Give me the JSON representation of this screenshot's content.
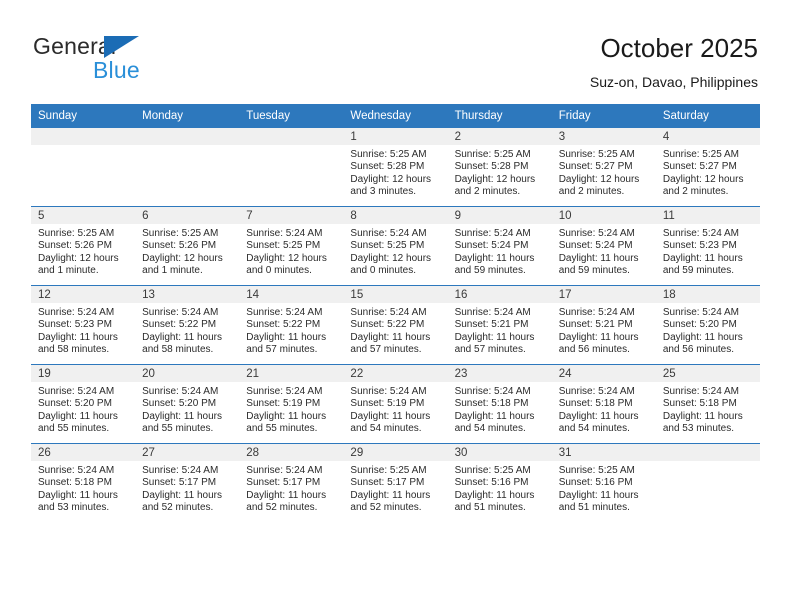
{
  "brand": {
    "name_top": "General",
    "name_bottom": "Blue",
    "accent_color": "#2a8fd8",
    "triangle_color": "#1b6cb5"
  },
  "header": {
    "title": "October 2025",
    "subtitle": "Suz-on, Davao, Philippines"
  },
  "theme": {
    "header_band": "#2d78bd",
    "daynum_band": "#f0f0f0",
    "text": "#2b2b2b"
  },
  "weekday_headers": [
    "Sunday",
    "Monday",
    "Tuesday",
    "Wednesday",
    "Thursday",
    "Friday",
    "Saturday"
  ],
  "weeks": [
    [
      {
        "day": "",
        "sunrise": "",
        "sunset": "",
        "daylight": ""
      },
      {
        "day": "",
        "sunrise": "",
        "sunset": "",
        "daylight": ""
      },
      {
        "day": "",
        "sunrise": "",
        "sunset": "",
        "daylight": ""
      },
      {
        "day": "1",
        "sunrise": "Sunrise: 5:25 AM",
        "sunset": "Sunset: 5:28 PM",
        "daylight": "Daylight: 12 hours and 3 minutes."
      },
      {
        "day": "2",
        "sunrise": "Sunrise: 5:25 AM",
        "sunset": "Sunset: 5:28 PM",
        "daylight": "Daylight: 12 hours and 2 minutes."
      },
      {
        "day": "3",
        "sunrise": "Sunrise: 5:25 AM",
        "sunset": "Sunset: 5:27 PM",
        "daylight": "Daylight: 12 hours and 2 minutes."
      },
      {
        "day": "4",
        "sunrise": "Sunrise: 5:25 AM",
        "sunset": "Sunset: 5:27 PM",
        "daylight": "Daylight: 12 hours and 2 minutes."
      }
    ],
    [
      {
        "day": "5",
        "sunrise": "Sunrise: 5:25 AM",
        "sunset": "Sunset: 5:26 PM",
        "daylight": "Daylight: 12 hours and 1 minute."
      },
      {
        "day": "6",
        "sunrise": "Sunrise: 5:25 AM",
        "sunset": "Sunset: 5:26 PM",
        "daylight": "Daylight: 12 hours and 1 minute."
      },
      {
        "day": "7",
        "sunrise": "Sunrise: 5:24 AM",
        "sunset": "Sunset: 5:25 PM",
        "daylight": "Daylight: 12 hours and 0 minutes."
      },
      {
        "day": "8",
        "sunrise": "Sunrise: 5:24 AM",
        "sunset": "Sunset: 5:25 PM",
        "daylight": "Daylight: 12 hours and 0 minutes."
      },
      {
        "day": "9",
        "sunrise": "Sunrise: 5:24 AM",
        "sunset": "Sunset: 5:24 PM",
        "daylight": "Daylight: 11 hours and 59 minutes."
      },
      {
        "day": "10",
        "sunrise": "Sunrise: 5:24 AM",
        "sunset": "Sunset: 5:24 PM",
        "daylight": "Daylight: 11 hours and 59 minutes."
      },
      {
        "day": "11",
        "sunrise": "Sunrise: 5:24 AM",
        "sunset": "Sunset: 5:23 PM",
        "daylight": "Daylight: 11 hours and 59 minutes."
      }
    ],
    [
      {
        "day": "12",
        "sunrise": "Sunrise: 5:24 AM",
        "sunset": "Sunset: 5:23 PM",
        "daylight": "Daylight: 11 hours and 58 minutes."
      },
      {
        "day": "13",
        "sunrise": "Sunrise: 5:24 AM",
        "sunset": "Sunset: 5:22 PM",
        "daylight": "Daylight: 11 hours and 58 minutes."
      },
      {
        "day": "14",
        "sunrise": "Sunrise: 5:24 AM",
        "sunset": "Sunset: 5:22 PM",
        "daylight": "Daylight: 11 hours and 57 minutes."
      },
      {
        "day": "15",
        "sunrise": "Sunrise: 5:24 AM",
        "sunset": "Sunset: 5:22 PM",
        "daylight": "Daylight: 11 hours and 57 minutes."
      },
      {
        "day": "16",
        "sunrise": "Sunrise: 5:24 AM",
        "sunset": "Sunset: 5:21 PM",
        "daylight": "Daylight: 11 hours and 57 minutes."
      },
      {
        "day": "17",
        "sunrise": "Sunrise: 5:24 AM",
        "sunset": "Sunset: 5:21 PM",
        "daylight": "Daylight: 11 hours and 56 minutes."
      },
      {
        "day": "18",
        "sunrise": "Sunrise: 5:24 AM",
        "sunset": "Sunset: 5:20 PM",
        "daylight": "Daylight: 11 hours and 56 minutes."
      }
    ],
    [
      {
        "day": "19",
        "sunrise": "Sunrise: 5:24 AM",
        "sunset": "Sunset: 5:20 PM",
        "daylight": "Daylight: 11 hours and 55 minutes."
      },
      {
        "day": "20",
        "sunrise": "Sunrise: 5:24 AM",
        "sunset": "Sunset: 5:20 PM",
        "daylight": "Daylight: 11 hours and 55 minutes."
      },
      {
        "day": "21",
        "sunrise": "Sunrise: 5:24 AM",
        "sunset": "Sunset: 5:19 PM",
        "daylight": "Daylight: 11 hours and 55 minutes."
      },
      {
        "day": "22",
        "sunrise": "Sunrise: 5:24 AM",
        "sunset": "Sunset: 5:19 PM",
        "daylight": "Daylight: 11 hours and 54 minutes."
      },
      {
        "day": "23",
        "sunrise": "Sunrise: 5:24 AM",
        "sunset": "Sunset: 5:18 PM",
        "daylight": "Daylight: 11 hours and 54 minutes."
      },
      {
        "day": "24",
        "sunrise": "Sunrise: 5:24 AM",
        "sunset": "Sunset: 5:18 PM",
        "daylight": "Daylight: 11 hours and 54 minutes."
      },
      {
        "day": "25",
        "sunrise": "Sunrise: 5:24 AM",
        "sunset": "Sunset: 5:18 PM",
        "daylight": "Daylight: 11 hours and 53 minutes."
      }
    ],
    [
      {
        "day": "26",
        "sunrise": "Sunrise: 5:24 AM",
        "sunset": "Sunset: 5:18 PM",
        "daylight": "Daylight: 11 hours and 53 minutes."
      },
      {
        "day": "27",
        "sunrise": "Sunrise: 5:24 AM",
        "sunset": "Sunset: 5:17 PM",
        "daylight": "Daylight: 11 hours and 52 minutes."
      },
      {
        "day": "28",
        "sunrise": "Sunrise: 5:24 AM",
        "sunset": "Sunset: 5:17 PM",
        "daylight": "Daylight: 11 hours and 52 minutes."
      },
      {
        "day": "29",
        "sunrise": "Sunrise: 5:25 AM",
        "sunset": "Sunset: 5:17 PM",
        "daylight": "Daylight: 11 hours and 52 minutes."
      },
      {
        "day": "30",
        "sunrise": "Sunrise: 5:25 AM",
        "sunset": "Sunset: 5:16 PM",
        "daylight": "Daylight: 11 hours and 51 minutes."
      },
      {
        "day": "31",
        "sunrise": "Sunrise: 5:25 AM",
        "sunset": "Sunset: 5:16 PM",
        "daylight": "Daylight: 11 hours and 51 minutes."
      },
      {
        "day": "",
        "sunrise": "",
        "sunset": "",
        "daylight": ""
      }
    ]
  ]
}
